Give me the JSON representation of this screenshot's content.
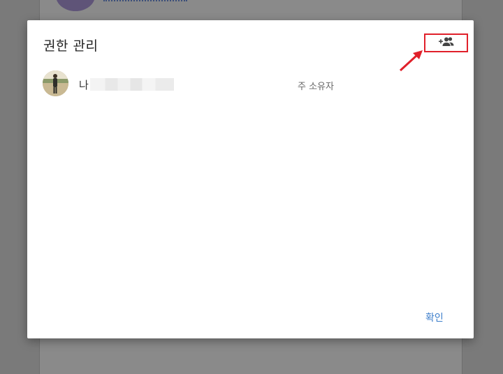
{
  "dialog": {
    "title": "권한 관리",
    "add_people_icon": "person-add-icon",
    "confirm_label": "확인",
    "accent_color": "#3d7ecb",
    "highlight_color": "#e0202a"
  },
  "members": [
    {
      "name_prefix": "나",
      "role": "주 소유자",
      "avatar": "user-photo"
    }
  ]
}
